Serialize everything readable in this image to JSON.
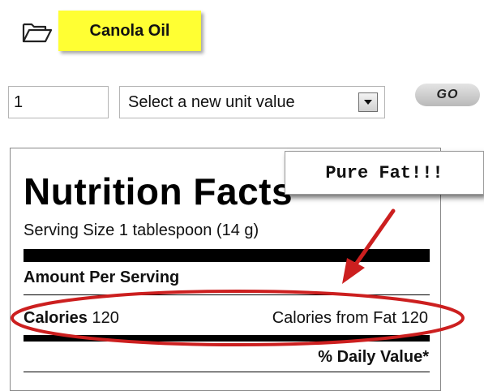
{
  "product": {
    "icon": "open-folder-icon",
    "name": "Canola Oil"
  },
  "controls": {
    "quantity_value": "1",
    "unit_select": {
      "selected": "Select a new unit value"
    },
    "go_label": "GO"
  },
  "nutrition": {
    "title": "Nutrition Facts",
    "serving_size": "Serving Size 1 tablespoon (14 g)",
    "amount_per_serving": "Amount Per Serving",
    "calories_label": "Calories",
    "calories_value": "120",
    "calories_from_fat_label": "Calories from Fat",
    "calories_from_fat_value": "120",
    "daily_value_header": "% Daily Value*"
  },
  "annotation": {
    "callout_text": "Pure Fat!!!",
    "color": "#cc1f1f"
  },
  "colors": {
    "tag_background": "#ffff33",
    "annotation_red": "#cc1f1f"
  }
}
